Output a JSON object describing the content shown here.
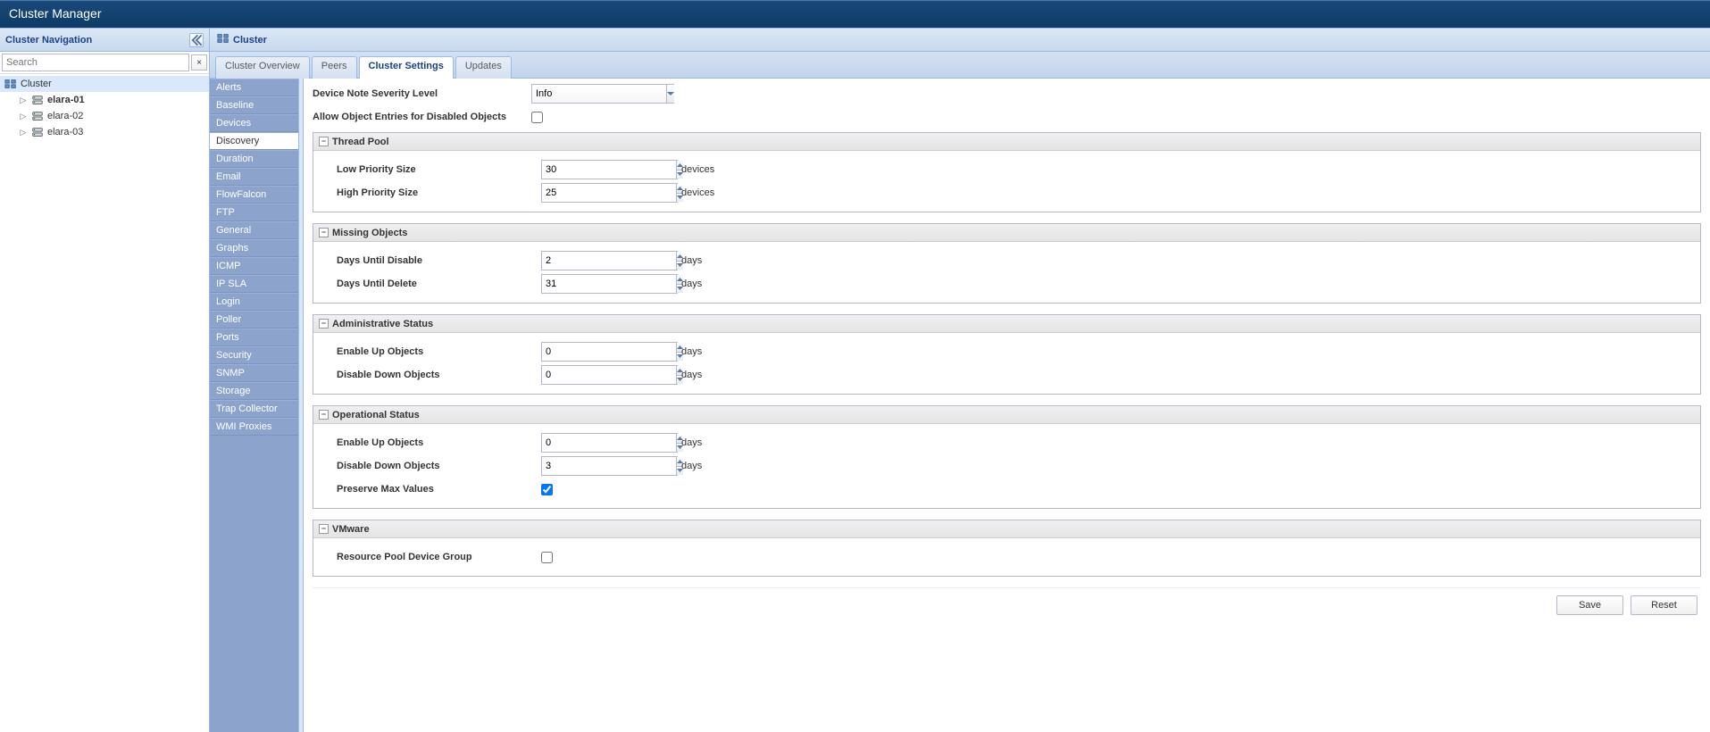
{
  "title": "Cluster Manager",
  "left_panel": {
    "title": "Cluster Navigation",
    "search_placeholder": "Search",
    "tree": {
      "root": "Cluster",
      "nodes": [
        "elara-01",
        "elara-02",
        "elara-03"
      ]
    }
  },
  "right_header": "Cluster",
  "tabs": [
    "Cluster Overview",
    "Peers",
    "Cluster Settings",
    "Updates"
  ],
  "tabs_active": "Cluster Settings",
  "side_list": [
    "Alerts",
    "Baseline",
    "Devices",
    "Discovery",
    "Duration",
    "Email",
    "FlowFalcon",
    "FTP",
    "General",
    "Graphs",
    "ICMP",
    "IP SLA",
    "Login",
    "Poller",
    "Ports",
    "Security",
    "SNMP",
    "Storage",
    "Trap Collector",
    "WMI Proxies"
  ],
  "side_list_selected": "Discovery",
  "form": {
    "device_note_severity_label": "Device Note Severity Level",
    "device_note_severity_value": "Info",
    "allow_disabled_label": "Allow Object Entries for Disabled Objects",
    "allow_disabled_checked": false,
    "sections": {
      "thread_pool": {
        "title": "Thread Pool",
        "low_label": "Low Priority Size",
        "low_value": "30",
        "low_unit": "devices",
        "high_label": "High Priority Size",
        "high_value": "25",
        "high_unit": "devices"
      },
      "missing": {
        "title": "Missing Objects",
        "disable_label": "Days Until Disable",
        "disable_value": "2",
        "disable_unit": "days",
        "delete_label": "Days Until Delete",
        "delete_value": "31",
        "delete_unit": "days"
      },
      "admin": {
        "title": "Administrative Status",
        "up_label": "Enable Up Objects",
        "up_value": "0",
        "up_unit": "days",
        "down_label": "Disable Down Objects",
        "down_value": "0",
        "down_unit": "days"
      },
      "oper": {
        "title": "Operational Status",
        "up_label": "Enable Up Objects",
        "up_value": "0",
        "up_unit": "days",
        "down_label": "Disable Down Objects",
        "down_value": "3",
        "down_unit": "days",
        "preserve_label": "Preserve Max Values",
        "preserve_checked": true
      },
      "vmware": {
        "title": "VMware",
        "pool_label": "Resource Pool Device Group",
        "pool_checked": false
      }
    }
  },
  "buttons": {
    "save": "Save",
    "reset": "Reset"
  }
}
